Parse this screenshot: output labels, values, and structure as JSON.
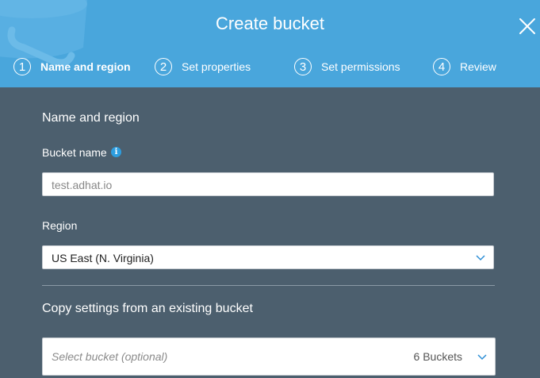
{
  "modal": {
    "title": "Create bucket",
    "close_icon": "close-icon"
  },
  "steps": [
    {
      "number": "1",
      "label": "Name and region",
      "active": true
    },
    {
      "number": "2",
      "label": "Set properties",
      "active": false
    },
    {
      "number": "3",
      "label": "Set permissions",
      "active": false
    },
    {
      "number": "4",
      "label": "Review",
      "active": false
    }
  ],
  "form": {
    "section_title": "Name and region",
    "bucket_name_label": "Bucket name",
    "bucket_name_info_icon": "info-icon",
    "bucket_name_value": "test.adhat.io",
    "region_label": "Region",
    "region_value": "US East (N. Virginia)",
    "copy_title": "Copy settings from an existing bucket",
    "copy_placeholder": "Select bucket (optional)",
    "copy_count": "6 Buckets"
  },
  "colors": {
    "header_bg": "#49a6dc",
    "body_bg": "#4c5f6e",
    "info_blue": "#2d9ee0",
    "chevron_blue": "#2d8fd6"
  }
}
